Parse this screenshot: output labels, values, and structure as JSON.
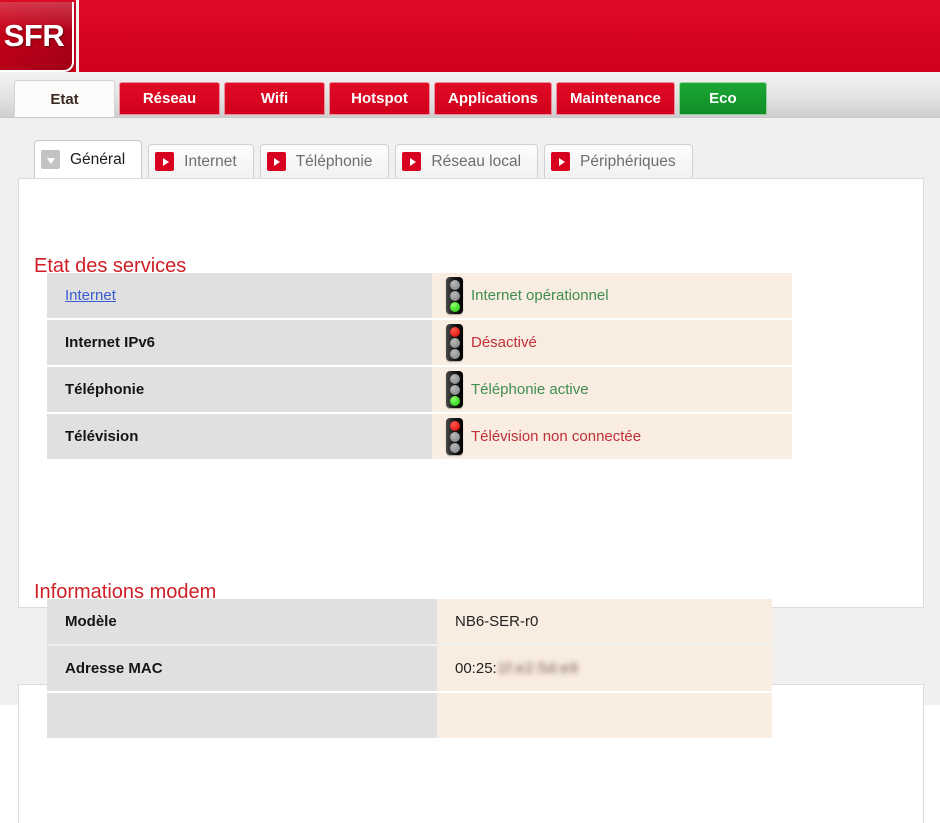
{
  "brand": {
    "logo_text": "SFR",
    "accent_red": "#d8001f",
    "accent_green": "#169b2f",
    "title_red": "#cf1e26"
  },
  "nav": {
    "tabs": [
      {
        "label": "Etat",
        "active": true,
        "style": "active"
      },
      {
        "label": "Réseau",
        "active": false,
        "style": "red"
      },
      {
        "label": "Wifi",
        "active": false,
        "style": "red"
      },
      {
        "label": "Hotspot",
        "active": false,
        "style": "red"
      },
      {
        "label": "Applications",
        "active": false,
        "style": "red"
      },
      {
        "label": "Maintenance",
        "active": false,
        "style": "red"
      },
      {
        "label": "Eco",
        "active": false,
        "style": "green"
      }
    ]
  },
  "subnav": {
    "tabs": [
      {
        "label": "Général",
        "active": true
      },
      {
        "label": "Internet",
        "active": false
      },
      {
        "label": "Téléphonie",
        "active": false
      },
      {
        "label": "Réseau local",
        "active": false
      },
      {
        "label": "Périphériques",
        "active": false
      }
    ]
  },
  "services": {
    "title": "Etat des services",
    "rows": [
      {
        "label": "Internet",
        "is_link": true,
        "status": "Internet opérationnel",
        "state": "ok",
        "lamp": "green-bottom"
      },
      {
        "label": "Internet IPv6",
        "is_link": false,
        "status": "Désactivé",
        "state": "bad",
        "lamp": "red-top"
      },
      {
        "label": "Téléphonie",
        "is_link": false,
        "status": "Téléphonie active",
        "state": "ok",
        "lamp": "green-bottom"
      },
      {
        "label": "Télévision",
        "is_link": false,
        "status": "Télévision non connectée",
        "state": "bad",
        "lamp": "red-top"
      }
    ]
  },
  "modem": {
    "title": "Informations modem",
    "rows": [
      {
        "label": "Modèle",
        "value": "NB6-SER-r0",
        "redacted": ""
      },
      {
        "label": "Adresse MAC",
        "value": "00:25:",
        "redacted": "1f:e2:5d:e9"
      },
      {
        "label": "",
        "value": "",
        "redacted": ""
      }
    ]
  }
}
